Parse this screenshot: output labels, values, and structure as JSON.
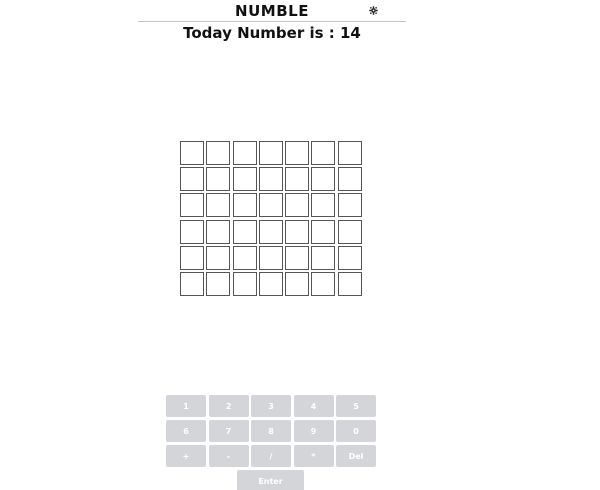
{
  "header": {
    "title": "NUMBLE",
    "settings_icon": "gear-icon"
  },
  "subtitle": "Today Number is : 14",
  "board": {
    "rows": 6,
    "columns": 7,
    "tiles": [
      [
        "",
        "",
        "",
        "",
        "",
        "",
        ""
      ],
      [
        "",
        "",
        "",
        "",
        "",
        "",
        ""
      ],
      [
        "",
        "",
        "",
        "",
        "",
        "",
        ""
      ],
      [
        "",
        "",
        "",
        "",
        "",
        "",
        ""
      ],
      [
        "",
        "",
        "",
        "",
        "",
        "",
        ""
      ],
      [
        "",
        "",
        "",
        "",
        "",
        "",
        ""
      ]
    ]
  },
  "keyboard": {
    "rows": [
      [
        "1",
        "2",
        "3",
        "4",
        "5"
      ],
      [
        "6",
        "7",
        "8",
        "9",
        "0"
      ],
      [
        "+",
        "-",
        "/",
        "*",
        "Del"
      ]
    ],
    "enter_label": "Enter",
    "key_color": "#d3d5d8",
    "key_text_color": "#ffffff"
  }
}
